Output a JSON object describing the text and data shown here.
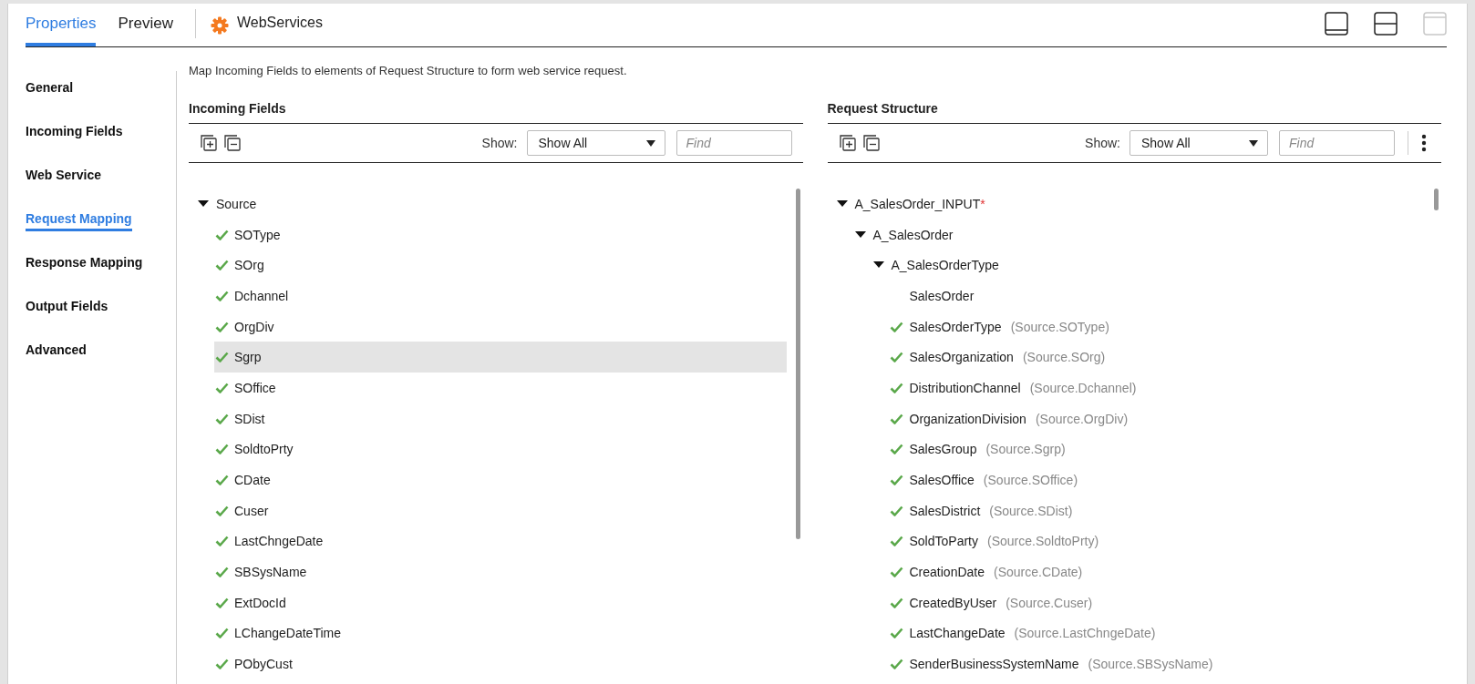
{
  "tabs": [
    {
      "label": "Properties",
      "selected": true
    },
    {
      "label": "Preview",
      "selected": false
    }
  ],
  "object": {
    "title": "WebServices"
  },
  "view_buttons": [
    {
      "kind": "bottom",
      "disabled": false
    },
    {
      "kind": "split",
      "disabled": false
    },
    {
      "kind": "top",
      "disabled": true
    }
  ],
  "sidebar": {
    "items": [
      {
        "label": "General",
        "selected": false
      },
      {
        "label": "Incoming Fields",
        "selected": false
      },
      {
        "label": "Web Service",
        "selected": false
      },
      {
        "label": "Request Mapping",
        "selected": true
      },
      {
        "label": "Response Mapping",
        "selected": false
      },
      {
        "label": "Output Fields",
        "selected": false
      },
      {
        "label": "Advanced",
        "selected": false
      }
    ]
  },
  "description": "Map Incoming Fields to elements of Request Structure to form web service request.",
  "panels": [
    {
      "title": "Incoming Fields",
      "show_label": "Show:",
      "show_value": "Show All",
      "find_placeholder": "Find",
      "tree": [
        {
          "label": "Source",
          "expanded": true,
          "selected": false,
          "children": [
            {
              "label": "SOType",
              "mapped": true,
              "selected": false
            },
            {
              "label": "SOrg",
              "mapped": true,
              "selected": false
            },
            {
              "label": "Dchannel",
              "mapped": true,
              "selected": false
            },
            {
              "label": "OrgDiv",
              "mapped": true,
              "selected": false
            },
            {
              "label": "Sgrp",
              "mapped": true,
              "selected": true
            },
            {
              "label": "SOffice",
              "mapped": true,
              "selected": false
            },
            {
              "label": "SDist",
              "mapped": true,
              "selected": false
            },
            {
              "label": "SoldtoPrty",
              "mapped": true,
              "selected": false
            },
            {
              "label": "CDate",
              "mapped": true,
              "selected": false
            },
            {
              "label": "Cuser",
              "mapped": true,
              "selected": false
            },
            {
              "label": "LastChngeDate",
              "mapped": true,
              "selected": false
            },
            {
              "label": "SBSysName",
              "mapped": true,
              "selected": false
            },
            {
              "label": "ExtDocId",
              "mapped": true,
              "selected": false
            },
            {
              "label": "LChangeDateTime",
              "mapped": true,
              "selected": false
            },
            {
              "label": "PObyCust",
              "mapped": true,
              "selected": false
            }
          ]
        }
      ]
    },
    {
      "title": "Request Structure",
      "show_label": "Show:",
      "show_value": "Show All",
      "find_placeholder": "Find",
      "has_menu": true,
      "tree": [
        {
          "label": "A_SalesOrder_INPUT",
          "required_mark": "*",
          "expanded": true,
          "selected": false,
          "children": [
            {
              "label": "A_SalesOrder",
              "expanded": true,
              "selected": false,
              "children": [
                {
                  "label": "A_SalesOrderType",
                  "expanded": true,
                  "selected": false,
                  "children": [
                    {
                      "label": "SalesOrder",
                      "mapped": false,
                      "selected": false
                    },
                    {
                      "label": "SalesOrderType",
                      "mapping": "(Source.SOType)",
                      "mapped": true,
                      "selected": false
                    },
                    {
                      "label": "SalesOrganization",
                      "mapping": "(Source.SOrg)",
                      "mapped": true,
                      "selected": false
                    },
                    {
                      "label": "DistributionChannel",
                      "mapping": "(Source.Dchannel)",
                      "mapped": true,
                      "selected": false
                    },
                    {
                      "label": "OrganizationDivision",
                      "mapping": "(Source.OrgDiv)",
                      "mapped": true,
                      "selected": false
                    },
                    {
                      "label": "SalesGroup",
                      "mapping": "(Source.Sgrp)",
                      "mapped": true,
                      "selected": false
                    },
                    {
                      "label": "SalesOffice",
                      "mapping": "(Source.SOffice)",
                      "mapped": true,
                      "selected": false
                    },
                    {
                      "label": "SalesDistrict",
                      "mapping": "(Source.SDist)",
                      "mapped": true,
                      "selected": false
                    },
                    {
                      "label": "SoldToParty",
                      "mapping": "(Source.SoldtoPrty)",
                      "mapped": true,
                      "selected": false
                    },
                    {
                      "label": "CreationDate",
                      "mapping": "(Source.CDate)",
                      "mapped": true,
                      "selected": false
                    },
                    {
                      "label": "CreatedByUser",
                      "mapping": "(Source.Cuser)",
                      "mapped": true,
                      "selected": false
                    },
                    {
                      "label": "LastChangeDate",
                      "mapping": "(Source.LastChngeDate)",
                      "mapped": true,
                      "selected": false
                    },
                    {
                      "label": "SenderBusinessSystemName",
                      "mapping": "(Source.SBSysName)",
                      "mapped": true,
                      "selected": false
                    }
                  ]
                }
              ]
            }
          ]
        }
      ]
    }
  ]
}
